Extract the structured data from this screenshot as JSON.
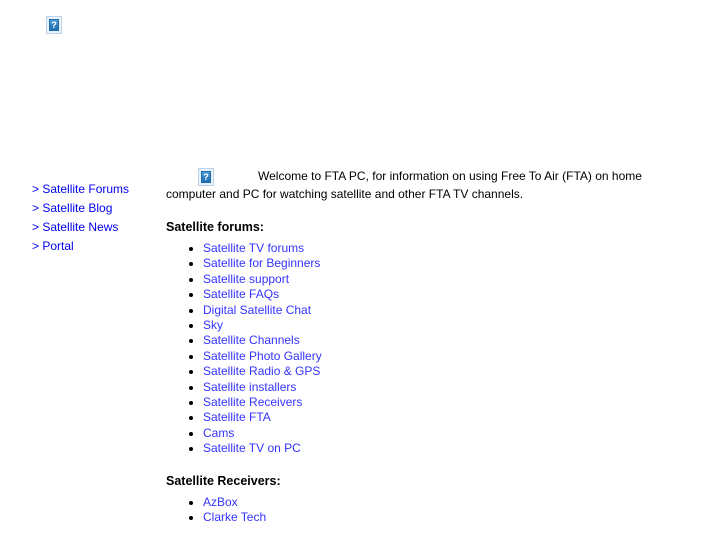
{
  "page": {
    "background_color": "#ffffff",
    "link_color": "#3333ff",
    "sidebar_link_color": "#0000ee",
    "text_color": "#000000"
  },
  "banner": {
    "image_alt_icon": "broken-image-icon",
    "placeholder_glyph": "?"
  },
  "sidebar": {
    "items": [
      {
        "arrow": ">",
        "label": "Satellite Forums"
      },
      {
        "arrow": ">",
        "label": "Satellite Blog"
      },
      {
        "arrow": ">",
        "label": "Satellite News"
      },
      {
        "arrow": ">",
        "label": "Portal"
      }
    ]
  },
  "main": {
    "intro_image_alt_icon": "broken-image-icon",
    "intro_placeholder_glyph": "?",
    "intro_text": "Welcome to FTA PC, for information on using Free To Air (FTA) on home computer and PC for watching satellite and other FTA TV channels.",
    "sections": [
      {
        "heading": "Satellite forums:",
        "links": [
          "Satellite TV forums",
          "Satellite for Beginners",
          "Satellite support",
          "Satellite FAQs",
          "Digital Satellite Chat",
          "Sky",
          "Satellite Channels",
          "Satellite Photo Gallery",
          "Satellite Radio & GPS",
          "Satellite installers",
          "Satellite Receivers",
          "Satellite FTA",
          "Cams",
          "Satellite TV on PC"
        ]
      },
      {
        "heading": "Satellite Receivers:",
        "links": [
          "AzBox",
          "Clarke Tech"
        ]
      }
    ]
  }
}
